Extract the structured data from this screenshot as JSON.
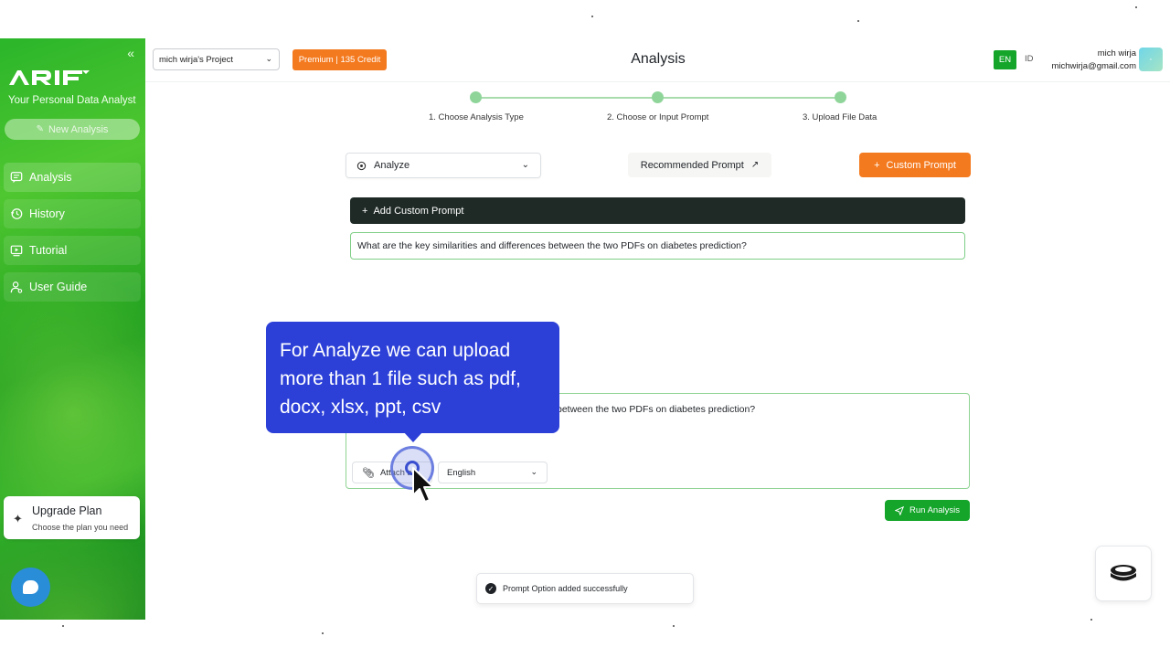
{
  "sidebar": {
    "collapse_icon": "double-chevron-left-icon",
    "tagline": "Your Personal Data Analyst",
    "new_analysis_label": "New Analysis",
    "items": [
      {
        "label": "Analysis",
        "icon": "message-square-icon"
      },
      {
        "label": "History",
        "icon": "history-icon"
      },
      {
        "label": "Tutorial",
        "icon": "video-play-icon"
      },
      {
        "label": "User Guide",
        "icon": "user-guide-icon"
      }
    ],
    "upgrade": {
      "title": "Upgrade Plan",
      "subtitle": "Choose the plan you need",
      "icon": "sparkle-icon"
    },
    "chat_icon": "chat-bubble-icon"
  },
  "header": {
    "project": "mich wirja's Project",
    "plan_badge": "Premium | 135 Credit",
    "title": "Analysis",
    "lang_en": "EN",
    "lang_id": "ID",
    "user_name": "mich wirja",
    "user_email": "michwirja@gmail.com"
  },
  "stepper": {
    "steps": [
      {
        "label": "1. Choose Analysis Type"
      },
      {
        "label": "2. Choose or Input Prompt"
      },
      {
        "label": "3. Upload File Data"
      }
    ]
  },
  "controls": {
    "analysis_type": "Analyze",
    "recommended_label": "Recommended Prompt",
    "custom_label": "Custom Prompt",
    "add_custom_label": "Add Custom Prompt",
    "prompt_option": "What are the key similarities and differences between the two PDFs on diabetes prediction?"
  },
  "main_input": {
    "visible_text": "between the two PDFs on diabetes prediction?",
    "attach_label": "Attach a fi",
    "language": "English",
    "run_label": "Run Analysis"
  },
  "tooltip": {
    "text": "For Analyze we can upload more than 1 file such as pdf, docx, xlsx, ppt, csv"
  },
  "toast": {
    "message": "Prompt Option added successfully"
  },
  "colors": {
    "brand_green": "#14a52a",
    "accent_orange": "#f47a1f",
    "tooltip_blue": "#2c40d8",
    "dark_bar": "#1f2a26"
  }
}
